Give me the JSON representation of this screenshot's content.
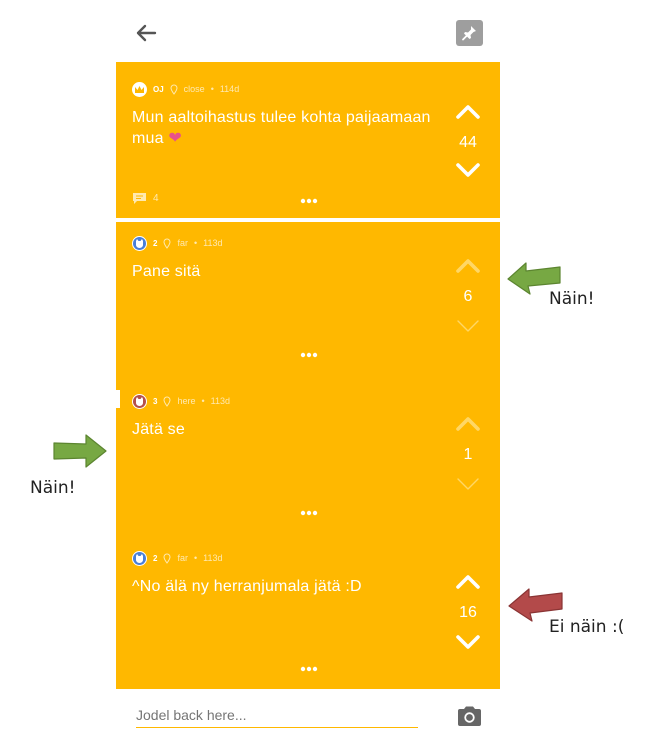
{
  "colors": {
    "card": "#ffb800",
    "text": "#ffffff",
    "muted": "#ffe9b0",
    "good_arrow": "#77a843",
    "bad_arrow": "#b34a4a"
  },
  "header": {
    "back_icon": "arrow-left-icon",
    "pin_icon": "pin-icon"
  },
  "op": {
    "author": "OJ",
    "location": "close",
    "age": "114d",
    "message": "Mun aaltoihastus tulee kohta paijaamaan mua",
    "emoji": "❤",
    "votes": "44",
    "comments": "4"
  },
  "replies": [
    {
      "number": "2",
      "location": "far",
      "age": "113d",
      "message": "Pane sitä",
      "votes": "6"
    },
    {
      "number": "3",
      "location": "here",
      "age": "113d",
      "message": "Jätä se",
      "votes": "1"
    },
    {
      "number": "2",
      "location": "far",
      "age": "113d",
      "message": "^No älä ny herranjumala jätä :D",
      "votes": "16"
    }
  ],
  "annotations": {
    "note_1": "Näin!",
    "note_2": "Näin!",
    "note_3": "Ei näin :("
  },
  "composer": {
    "placeholder": "Jodel back here..."
  }
}
